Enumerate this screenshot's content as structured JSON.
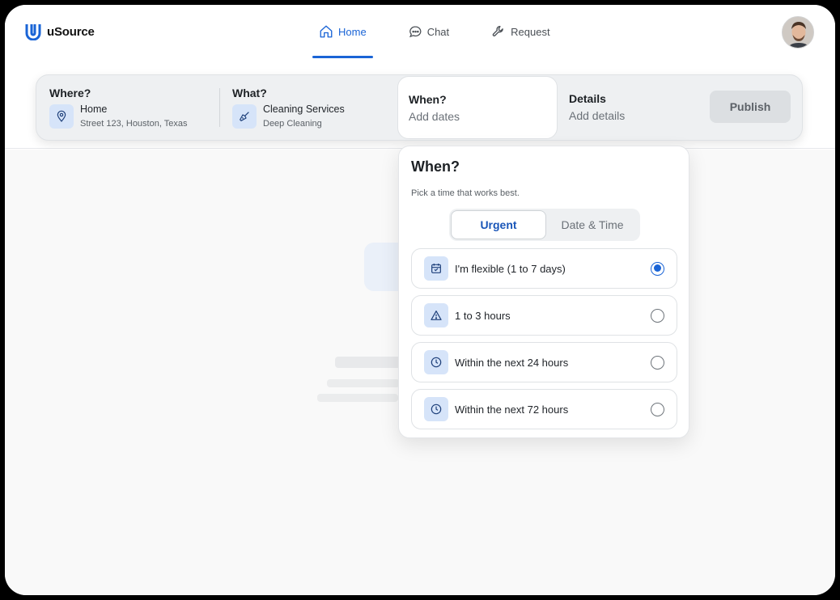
{
  "app": {
    "name": "uSource"
  },
  "nav": [
    {
      "label": "Home",
      "icon": "home-icon",
      "active": true
    },
    {
      "label": "Chat",
      "icon": "chat-icon",
      "active": false
    },
    {
      "label": "Request",
      "icon": "wrench-icon",
      "active": false
    }
  ],
  "searchbar": {
    "where": {
      "title": "Where?",
      "main": "Home",
      "sub": "Street 123, Houston, Texas",
      "icon": "location-pin-icon"
    },
    "what": {
      "title": "What?",
      "main": "Cleaning Services",
      "sub": "Deep Cleaning",
      "icon": "broom-icon"
    },
    "when": {
      "title": "When?",
      "placeholder": "Add dates"
    },
    "details": {
      "title": "Details",
      "placeholder": "Add details"
    },
    "publish_label": "Publish"
  },
  "popover": {
    "title": "When?",
    "subtitle": "Pick a time that works best.",
    "tabs": [
      {
        "label": "Urgent",
        "selected": true
      },
      {
        "label": "Date & Time",
        "selected": false
      }
    ],
    "options": [
      {
        "label": "I'm flexible (1 to 7 days)",
        "icon": "calendar-icon",
        "selected": true
      },
      {
        "label": "1 to 3 hours",
        "icon": "warning-triangle-icon",
        "selected": false
      },
      {
        "label": "Within the next 24 hours",
        "icon": "clock-icon",
        "selected": false
      },
      {
        "label": "Within the next 72 hours",
        "icon": "clock-icon",
        "selected": false
      }
    ]
  },
  "colors": {
    "accent": "#1a64d6",
    "icon_bg": "#d6e4f9",
    "bar_bg": "#eef0f2"
  }
}
